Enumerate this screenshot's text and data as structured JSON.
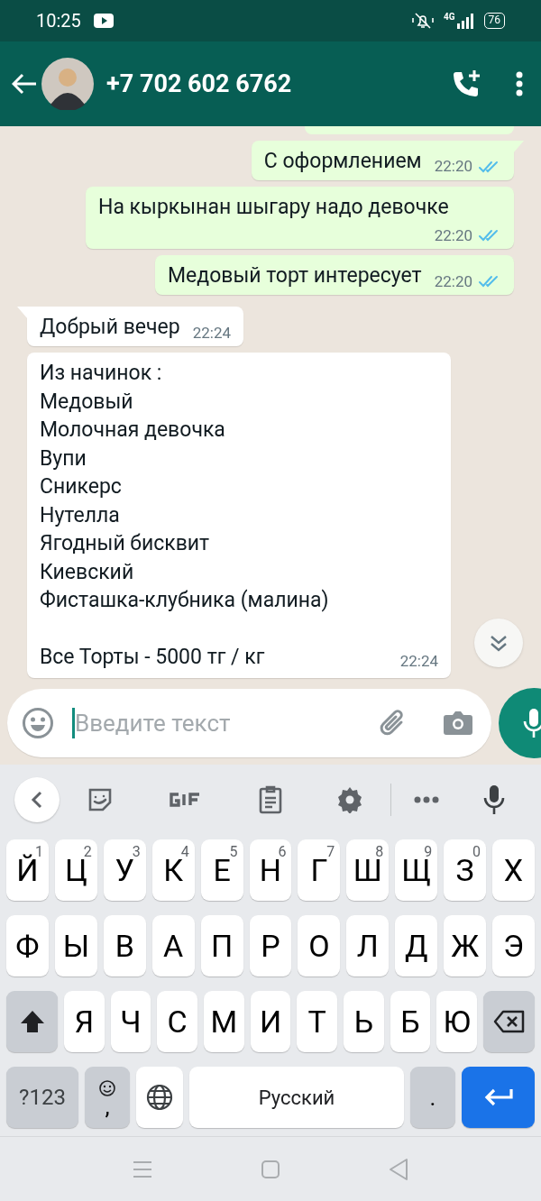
{
  "status_bar": {
    "time": "10:25",
    "network": "4G",
    "battery": "76"
  },
  "header": {
    "title": "+7 702 602 6762"
  },
  "messages": [
    {
      "kind": "cut",
      "outgoing": true
    },
    {
      "kind": "text",
      "outgoing": true,
      "text": "С оформлением",
      "time": "22:20",
      "read": true,
      "tail": true
    },
    {
      "kind": "text",
      "outgoing": true,
      "text": "На кыркынан шыгару надо девочке",
      "time": "22:20",
      "read": true,
      "tail": false
    },
    {
      "kind": "text",
      "outgoing": true,
      "text": "Медовый торт интересует",
      "time": "22:20",
      "read": true,
      "tail": false
    },
    {
      "kind": "text",
      "outgoing": false,
      "text": "Добрый вечер",
      "time": "22:24",
      "tail": true
    },
    {
      "kind": "text",
      "outgoing": false,
      "text": "Из начинок :\nМедовый\nМолочная девочка\nВупи\nСникерс\nНутелла\nЯгодный бисквит\nКиевский\nФисташка-клубника (малина)\n\nВсе Торты - 5000 тг / кг",
      "time": "22:24",
      "tail": false
    }
  ],
  "composer": {
    "placeholder": "Введите текст"
  },
  "keyboard": {
    "letter_rows": [
      [
        {
          "kind": "letter",
          "label": "Й",
          "hint": "1"
        },
        {
          "kind": "letter",
          "label": "Ц",
          "hint": "2"
        },
        {
          "kind": "letter",
          "label": "У",
          "hint": "3"
        },
        {
          "kind": "letter",
          "label": "К",
          "hint": "4"
        },
        {
          "kind": "letter",
          "label": "Е",
          "hint": "5"
        },
        {
          "kind": "letter",
          "label": "Н",
          "hint": "6"
        },
        {
          "kind": "letter",
          "label": "Г",
          "hint": "7"
        },
        {
          "kind": "letter",
          "label": "Ш",
          "hint": "8"
        },
        {
          "kind": "letter",
          "label": "Щ",
          "hint": "9"
        },
        {
          "kind": "letter",
          "label": "З",
          "hint": "0"
        },
        {
          "kind": "letter",
          "label": "Х"
        }
      ],
      [
        {
          "kind": "letter",
          "label": "Ф"
        },
        {
          "kind": "letter",
          "label": "Ы"
        },
        {
          "kind": "letter",
          "label": "В"
        },
        {
          "kind": "letter",
          "label": "А"
        },
        {
          "kind": "letter",
          "label": "П"
        },
        {
          "kind": "letter",
          "label": "Р"
        },
        {
          "kind": "letter",
          "label": "О"
        },
        {
          "kind": "letter",
          "label": "Л"
        },
        {
          "kind": "letter",
          "label": "Д"
        },
        {
          "kind": "letter",
          "label": "Ж"
        },
        {
          "kind": "letter",
          "label": "Э"
        }
      ],
      [
        {
          "kind": "shift"
        },
        {
          "kind": "letter",
          "label": "Я"
        },
        {
          "kind": "letter",
          "label": "Ч"
        },
        {
          "kind": "letter",
          "label": "С"
        },
        {
          "kind": "letter",
          "label": "М"
        },
        {
          "kind": "letter",
          "label": "И"
        },
        {
          "kind": "letter",
          "label": "Т"
        },
        {
          "kind": "letter",
          "label": "Ь"
        },
        {
          "kind": "letter",
          "label": "Б"
        },
        {
          "kind": "letter",
          "label": "Ю"
        },
        {
          "kind": "backspace"
        }
      ]
    ],
    "bottom_row": {
      "symbols": "?123",
      "comma": ",",
      "space": "Русский",
      "period": "."
    }
  }
}
